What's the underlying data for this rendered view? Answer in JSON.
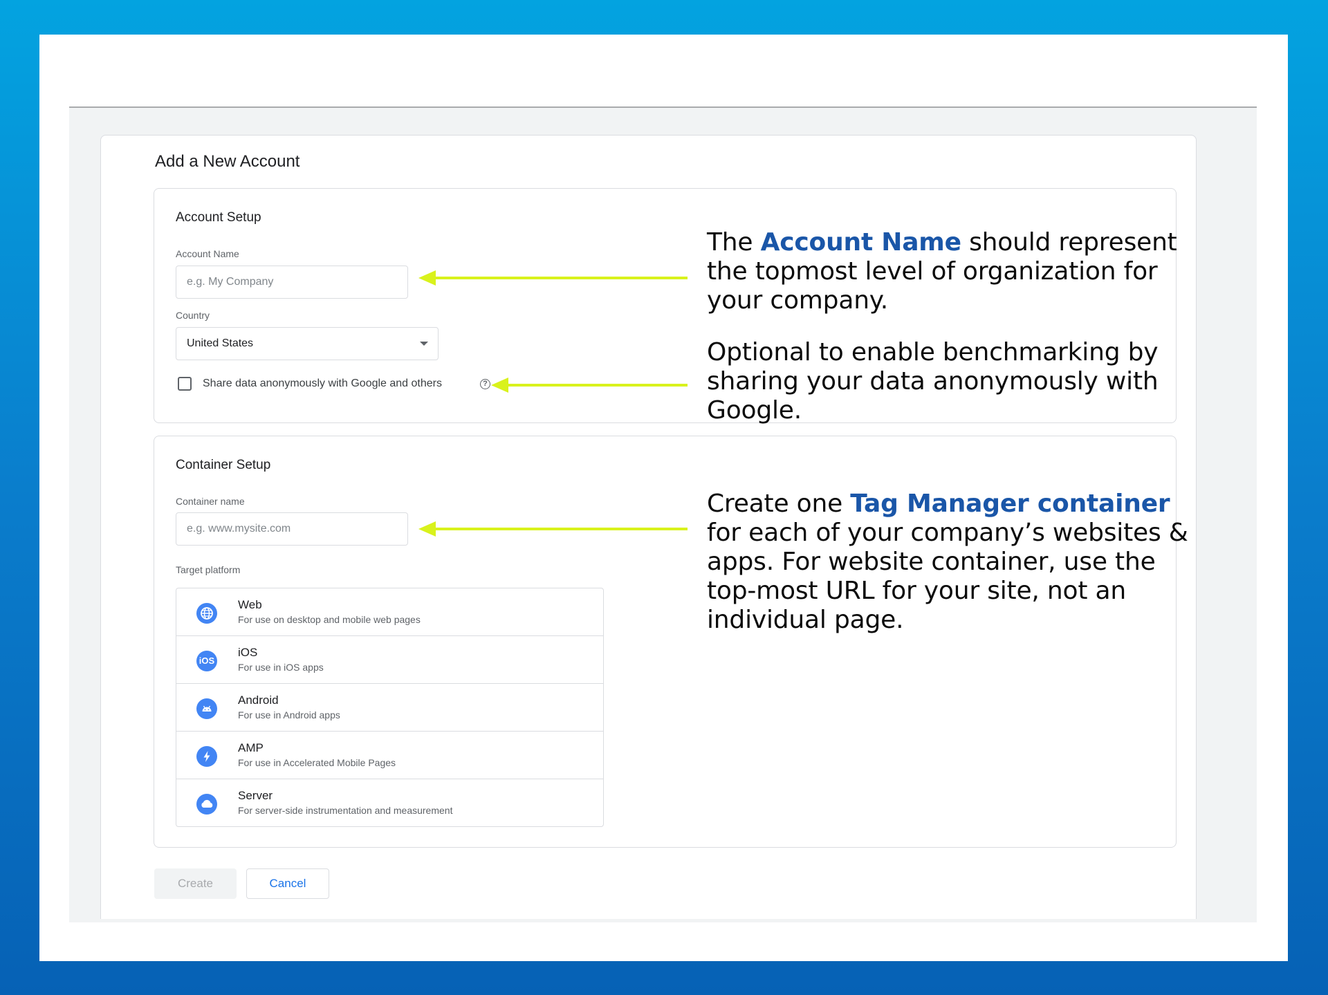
{
  "page": {
    "title": "Add a New Account"
  },
  "account_setup": {
    "title": "Account Setup",
    "account_name_label": "Account Name",
    "account_name_placeholder": "e.g. My Company",
    "country_label": "Country",
    "country_value": "United States",
    "share_label": "Share data anonymously with Google and others",
    "share_checked": false,
    "help_icon_glyph": "?"
  },
  "container_setup": {
    "title": "Container Setup",
    "container_name_label": "Container name",
    "container_name_placeholder": "e.g. www.mysite.com",
    "target_platform_label": "Target platform",
    "platforms": [
      {
        "name": "Web",
        "desc": "For use on desktop and mobile web pages",
        "icon": "globe-icon"
      },
      {
        "name": "iOS",
        "desc": "For use in iOS apps",
        "icon": "ios-icon",
        "glyph": "iOS"
      },
      {
        "name": "Android",
        "desc": "For use in Android apps",
        "icon": "android-icon"
      },
      {
        "name": "AMP",
        "desc": "For use in Accelerated Mobile Pages",
        "icon": "lightning-icon"
      },
      {
        "name": "Server",
        "desc": "For server-side instrumentation and measurement",
        "icon": "cloud-icon"
      }
    ]
  },
  "buttons": {
    "create": "Create",
    "cancel": "Cancel"
  },
  "annotations": {
    "account_name": {
      "pre": "The ",
      "bold": "Account Name",
      "post": " should represent the topmost level of organization for your company."
    },
    "share": {
      "text": "Optional to enable benchmarking by sharing your data anonymously with Google."
    },
    "container": {
      "pre": "Create one ",
      "bold": "Tag Manager container",
      "post": " for each of your company’s websites & apps. For website container, use the top-most URL for your site, not an individual page."
    }
  },
  "colors": {
    "background_top": "#03a3e0",
    "background_bottom": "#0661b5",
    "arrow": "#d9f21c",
    "annotation_highlight": "#1a56a8",
    "accent": "#1a73e8",
    "platform_icon": "#4285f4"
  }
}
